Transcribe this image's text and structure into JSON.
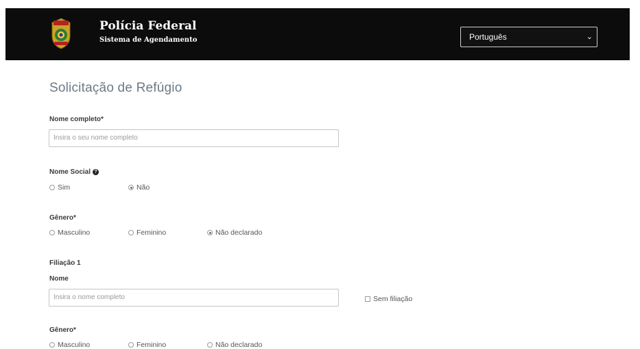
{
  "header": {
    "title": "Polícia Federal",
    "subtitle": "Sistema de Agendamento",
    "language": "Português",
    "brand_color": "#0c0c0c"
  },
  "page": {
    "title": "Solicitação de Refúgio"
  },
  "form": {
    "full_name": {
      "label": "Nome completo*",
      "placeholder": "Insira o seu nome completo"
    },
    "social_name": {
      "label": "Nome Social",
      "options": [
        "Sim",
        "Não"
      ],
      "selected": "Não"
    },
    "gender": {
      "label": "Gênero*",
      "options": [
        "Masculino",
        "Feminino",
        "Não declarado"
      ],
      "selected": "Não declarado"
    },
    "affiliation1": {
      "section_label": "Filiação 1",
      "name_label": "Nome",
      "placeholder": "Insira o nome completo",
      "no_affiliation": "Sem filiação",
      "gender_label": "Gênero*",
      "gender_options": [
        "Masculino",
        "Feminino",
        "Não declarado"
      ]
    }
  }
}
